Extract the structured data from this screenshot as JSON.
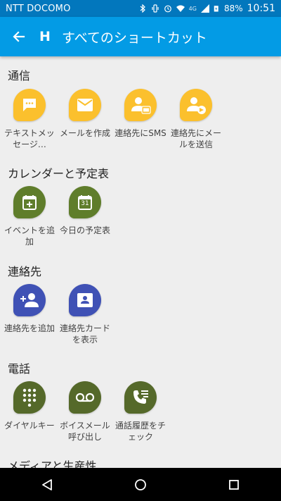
{
  "status_bar": {
    "carrier": "NTT DOCOMO",
    "battery": "88%",
    "time": "10:51",
    "network": "4G"
  },
  "app_bar": {
    "app_letter": "H",
    "title": "すべてのショートカット"
  },
  "sections": [
    {
      "title": "通信",
      "items": [
        {
          "label": "テキストメッセージ…",
          "icon": "message-icon",
          "color": "#fbc02d"
        },
        {
          "label": "メールを作成",
          "icon": "email-icon",
          "color": "#fbc02d"
        },
        {
          "label": "連絡先にSMS",
          "icon": "contact-sms-icon",
          "color": "#fbc02d"
        },
        {
          "label": "連絡先にメールを送信",
          "icon": "contact-email-icon",
          "color": "#fbc02d"
        }
      ]
    },
    {
      "title": "カレンダーと予定表",
      "items": [
        {
          "label": "イベントを追加",
          "icon": "calendar-add-icon",
          "color": "#5f7d2b"
        },
        {
          "label": "今日の予定表",
          "icon": "calendar-today-icon",
          "color": "#5f7d2b",
          "day": "31"
        }
      ]
    },
    {
      "title": "連絡先",
      "items": [
        {
          "label": "連絡先を追加",
          "icon": "add-contact-icon",
          "color": "#3f51b5"
        },
        {
          "label": "連絡先カードを表示",
          "icon": "contact-card-icon",
          "color": "#3f51b5"
        }
      ]
    },
    {
      "title": "電話",
      "items": [
        {
          "label": "ダイヤルキー",
          "icon": "dialpad-icon",
          "color": "#55692a"
        },
        {
          "label": "ボイスメール呼び出し",
          "icon": "voicemail-icon",
          "color": "#55692a"
        },
        {
          "label": "通話履歴をチェック",
          "icon": "call-log-icon",
          "color": "#55692a"
        }
      ]
    },
    {
      "title": "メディアと生産性",
      "items": []
    }
  ]
}
